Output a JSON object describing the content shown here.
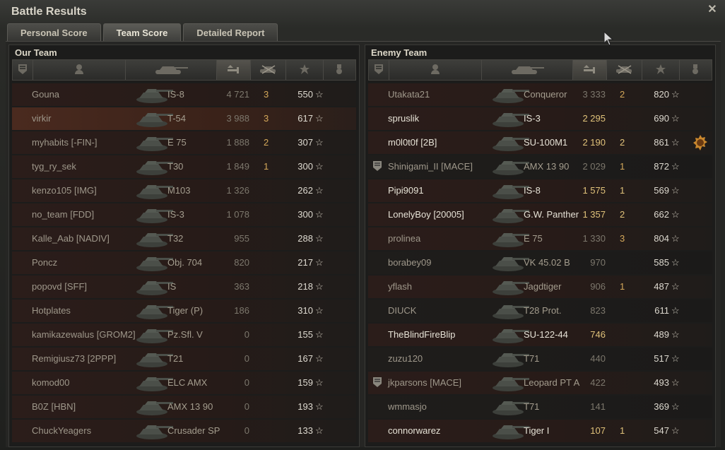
{
  "window": {
    "title": "Battle Results",
    "close_icon": "close-icon"
  },
  "tabs": [
    {
      "label": "Personal Score",
      "active": false
    },
    {
      "label": "Team Score",
      "active": true
    },
    {
      "label": "Detailed Report",
      "active": false
    }
  ],
  "our_team": {
    "title": "Our Team",
    "rows": [
      {
        "name": "Gouna",
        "tank": "IS-8",
        "damage": "4 721",
        "kills": "3",
        "xp": "550",
        "highlight": false,
        "bright": false
      },
      {
        "name": "virkir",
        "tank": "T-54",
        "damage": "3 988",
        "kills": "3",
        "xp": "617",
        "highlight": true,
        "bright": false
      },
      {
        "name": "myhabits [-FIN-]",
        "tank": "E 75",
        "damage": "1 888",
        "kills": "2",
        "xp": "307",
        "highlight": false,
        "bright": false
      },
      {
        "name": "tyg_ry_sek",
        "tank": "T30",
        "damage": "1 849",
        "kills": "1",
        "xp": "300",
        "highlight": false,
        "bright": false
      },
      {
        "name": "kenzo105 [IMG]",
        "tank": "M103",
        "damage": "1 326",
        "kills": "",
        "xp": "262",
        "highlight": false,
        "bright": false
      },
      {
        "name": "no_team [FDD]",
        "tank": "IS-3",
        "damage": "1 078",
        "kills": "",
        "xp": "300",
        "highlight": false,
        "bright": false
      },
      {
        "name": "Kalle_Aab [NADIV]",
        "tank": "T32",
        "damage": "955",
        "kills": "",
        "xp": "288",
        "highlight": false,
        "bright": false
      },
      {
        "name": "Poncz",
        "tank": "Obj. 704",
        "damage": "820",
        "kills": "",
        "xp": "217",
        "highlight": false,
        "bright": false
      },
      {
        "name": "popovd [SFF]",
        "tank": "IS",
        "damage": "363",
        "kills": "",
        "xp": "218",
        "highlight": false,
        "bright": false
      },
      {
        "name": "Hotplates",
        "tank": "Tiger (P)",
        "damage": "186",
        "kills": "",
        "xp": "310",
        "highlight": false,
        "bright": false
      },
      {
        "name": "kamikazewalus [GROM2]",
        "tank": "Pz.Sfl. V",
        "damage": "0",
        "kills": "",
        "xp": "155",
        "highlight": false,
        "bright": false
      },
      {
        "name": "Remigiusz73 [2PPP]",
        "tank": "T21",
        "damage": "0",
        "kills": "",
        "xp": "167",
        "highlight": false,
        "bright": false
      },
      {
        "name": "komod00",
        "tank": "ELC AMX",
        "damage": "0",
        "kills": "",
        "xp": "159",
        "highlight": false,
        "bright": false
      },
      {
        "name": "B0Z [HBN]",
        "tank": "AMX 13 90",
        "damage": "0",
        "kills": "",
        "xp": "193",
        "highlight": false,
        "bright": false
      },
      {
        "name": "ChuckYeagers",
        "tank": "Crusader SP",
        "damage": "0",
        "kills": "",
        "xp": "133",
        "highlight": false,
        "bright": false
      }
    ]
  },
  "enemy_team": {
    "title": "Enemy Team",
    "rows": [
      {
        "name": "Utakata21",
        "tank": "Conqueror",
        "damage": "3 333",
        "kills": "2",
        "xp": "820",
        "bright": false,
        "medal": false,
        "badge": false
      },
      {
        "name": "spruslik",
        "tank": "IS-3",
        "damage": "2 295",
        "kills": "",
        "xp": "690",
        "bright": true,
        "medal": false,
        "badge": false
      },
      {
        "name": "m0l0t0f [2B]",
        "tank": "SU-100M1",
        "damage": "2 190",
        "kills": "2",
        "xp": "861",
        "bright": true,
        "medal": true,
        "badge": false
      },
      {
        "name": "Shinigami_II [MACE]",
        "tank": "AMX 13 90",
        "damage": "2 029",
        "kills": "1",
        "xp": "872",
        "bright": false,
        "medal": false,
        "badge": true
      },
      {
        "name": "Pipi9091",
        "tank": "IS-8",
        "damage": "1 575",
        "kills": "1",
        "xp": "569",
        "bright": true,
        "medal": false,
        "badge": false
      },
      {
        "name": "LonelyBoy [20005]",
        "tank": "G.W. Panther",
        "damage": "1 357",
        "kills": "2",
        "xp": "662",
        "bright": true,
        "medal": false,
        "badge": false
      },
      {
        "name": "prolinea",
        "tank": "E 75",
        "damage": "1 330",
        "kills": "3",
        "xp": "804",
        "bright": false,
        "medal": false,
        "badge": false
      },
      {
        "name": "borabey09",
        "tank": "VK 45.02 B",
        "damage": "970",
        "kills": "",
        "xp": "585",
        "bright": false,
        "medal": false,
        "badge": false
      },
      {
        "name": "yflash",
        "tank": "Jagdtiger",
        "damage": "906",
        "kills": "1",
        "xp": "487",
        "bright": false,
        "medal": false,
        "badge": false
      },
      {
        "name": "DIUCK",
        "tank": "T28 Prot.",
        "damage": "823",
        "kills": "",
        "xp": "611",
        "bright": false,
        "medal": false,
        "badge": false
      },
      {
        "name": "TheBlindFireBlip",
        "tank": "SU-122-44",
        "damage": "746",
        "kills": "",
        "xp": "489",
        "bright": true,
        "medal": false,
        "badge": false
      },
      {
        "name": "zuzu120",
        "tank": "T71",
        "damage": "440",
        "kills": "",
        "xp": "517",
        "bright": false,
        "medal": false,
        "badge": false
      },
      {
        "name": "jkparsons [MACE]",
        "tank": "Leopard PT A",
        "damage": "422",
        "kills": "",
        "xp": "493",
        "bright": false,
        "medal": false,
        "badge": true
      },
      {
        "name": "wmmasjo",
        "tank": "T71",
        "damage": "141",
        "kills": "",
        "xp": "369",
        "bright": false,
        "medal": false,
        "badge": false
      },
      {
        "name": "connorwarez",
        "tank": "Tiger I",
        "damage": "107",
        "kills": "1",
        "xp": "547",
        "bright": true,
        "medal": false,
        "badge": false
      }
    ]
  },
  "columns": {
    "icons": [
      "rank-icon",
      "player-icon",
      "tank-icon",
      "damage-icon",
      "kills-icon",
      "xp-star-icon",
      "medal-icon"
    ],
    "sorted": "damage"
  },
  "star_glyph": "☆"
}
